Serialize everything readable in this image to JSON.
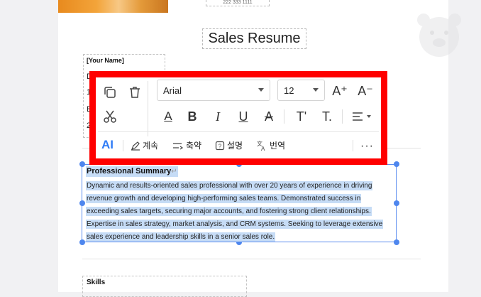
{
  "document": {
    "phone_partial": "222 333 1111",
    "title": "Sales Resume",
    "name_placeholder": "[Your Name]",
    "left_peek": [
      "D",
      "1",
      "E",
      "2"
    ],
    "summary": {
      "heading": "Professional Summary",
      "return_mark": "↵",
      "lines": [
        "Dynamic and results-oriented sales professional with over 20 years of experience in driving",
        "revenue growth and developing high-performing sales teams. Demonstrated success in",
        "exceeding sales targets, securing major accounts, and fostering strong client relationships.",
        "Expertise in sales strategy, market analysis, and CRM systems. Seeking to leverage extensive",
        "sales experience and leadership skills in a senior sales role."
      ]
    },
    "skills_heading": "Skills"
  },
  "toolbar": {
    "font_family": "Arial",
    "font_size": "12",
    "ai_label": "AI",
    "continue_label": "계속",
    "shorten_label": "축약",
    "explain_label": "설명",
    "translate_label": "번역",
    "more_label": "···",
    "highlight_color": "#ff0000"
  },
  "colors": {
    "selection": "#c6dcf6",
    "accent": "#2f7cf6",
    "handle": "#4e86ee"
  }
}
